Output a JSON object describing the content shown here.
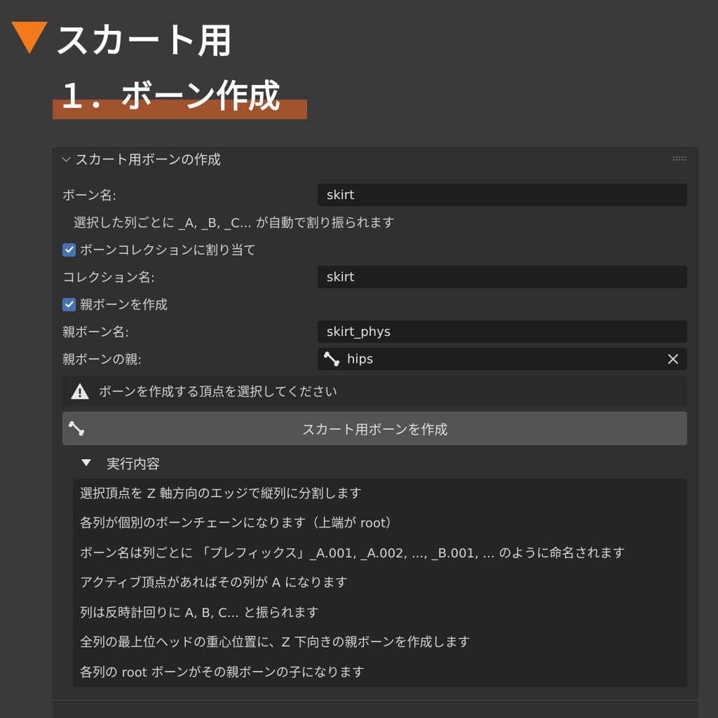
{
  "heading": {
    "title": "スカート用",
    "subtitle": "１．ボーン作成"
  },
  "panel": {
    "title": "スカート用ボーンの作成",
    "bone_name": {
      "label": "ボーン名:",
      "value": "skirt"
    },
    "bone_name_note": "選択した列ごとに _A, _B, _C... が自動で割り振られます",
    "assign_collection": {
      "label": "ボーンコレクションに割り当て",
      "checked": true
    },
    "collection_name": {
      "label": "コレクション名:",
      "value": "skirt"
    },
    "create_parent": {
      "label": "親ボーンを作成",
      "checked": true
    },
    "parent_bone_name": {
      "label": "親ボーン名:",
      "value": "skirt_phys"
    },
    "parent_of_parent": {
      "label": "親ボーンの親:",
      "value": "hips"
    },
    "warning": "ボーンを作成する頂点を選択してください",
    "action_button": "スカート用ボーンを作成",
    "details": {
      "title": "実行内容",
      "lines": [
        "選択頂点を Z 軸方向のエッジで縦列に分割します",
        "各列が個別のボーンチェーンになります（上端が root）",
        "ボーン名は列ごとに 「プレフィックス」_A.001, _A.002, ..., _B.001, ... のように命名されます",
        "アクティブ頂点があればその列が A になります",
        "列は反時計回りに A, B, C... と振られます",
        "全列の最上位ヘッドの重心位置に、Z 下向きの親ボーンを作成します",
        "各列の root ボーンがその親ボーンの子になります"
      ]
    }
  },
  "colors": {
    "accent_orange": "#f27a1a",
    "subtitle_band": "#a0522d",
    "checkbox_blue": "#4772b3",
    "panel_bg": "#303030",
    "field_bg": "#1e1e1e"
  },
  "icons": {
    "title_marker": "triangle-down-icon",
    "panel_toggle": "chevron-down-icon",
    "bone": "bone-icon",
    "warning": "warning-icon",
    "clear": "close-icon"
  }
}
